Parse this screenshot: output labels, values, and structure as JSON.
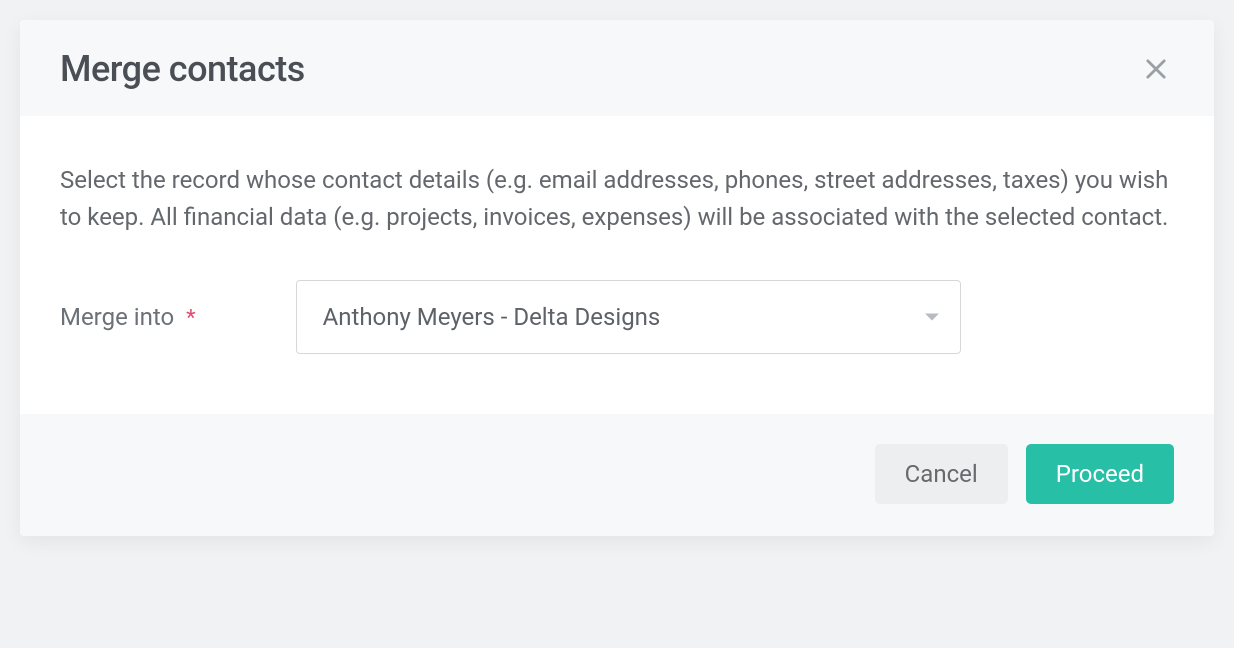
{
  "dialog": {
    "title": "Merge contacts",
    "description": "Select the record whose contact details (e.g. email addresses, phones, street addresses, taxes) you wish to keep. All financial data (e.g. projects, invoices, expenses) will be associated with the selected contact.",
    "field": {
      "label": "Merge into",
      "required_marker": "*",
      "selected_value": "Anthony Meyers - Delta Designs"
    },
    "buttons": {
      "cancel": "Cancel",
      "proceed": "Proceed"
    }
  }
}
